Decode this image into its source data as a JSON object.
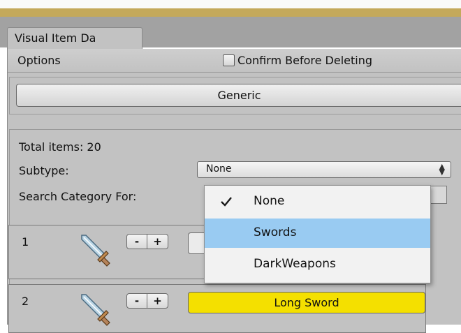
{
  "window": {
    "tab_title": "Visual Item Da"
  },
  "options": {
    "label": "Options",
    "confirm_label": "Confirm Before Deleting",
    "confirm_checked": false
  },
  "category_button": "Generic",
  "summary": {
    "total_items": "Total items: 20",
    "subtype_label": "Subtype:",
    "subtype_value": "None",
    "search_label": "Search Category For:"
  },
  "items": [
    {
      "index": "1",
      "minus": "-",
      "plus": "+",
      "name": "",
      "name_color": "#ebebeb",
      "icon": "sword-icon"
    },
    {
      "index": "2",
      "minus": "-",
      "plus": "+",
      "name": "Long Sword",
      "name_color": "#f4e000",
      "icon": "sword-icon"
    }
  ],
  "subtype_dropdown": {
    "options": [
      {
        "label": "None",
        "checked": true,
        "highlighted": false
      },
      {
        "label": "Swords",
        "checked": false,
        "highlighted": true
      },
      {
        "label": "DarkWeapons",
        "checked": false,
        "highlighted": false
      }
    ]
  },
  "colors": {
    "accent_bar": "#c4a95b",
    "panel": "#c2c2c2",
    "highlight": "#99cbf2",
    "item_name_bg": "#f4e000"
  }
}
